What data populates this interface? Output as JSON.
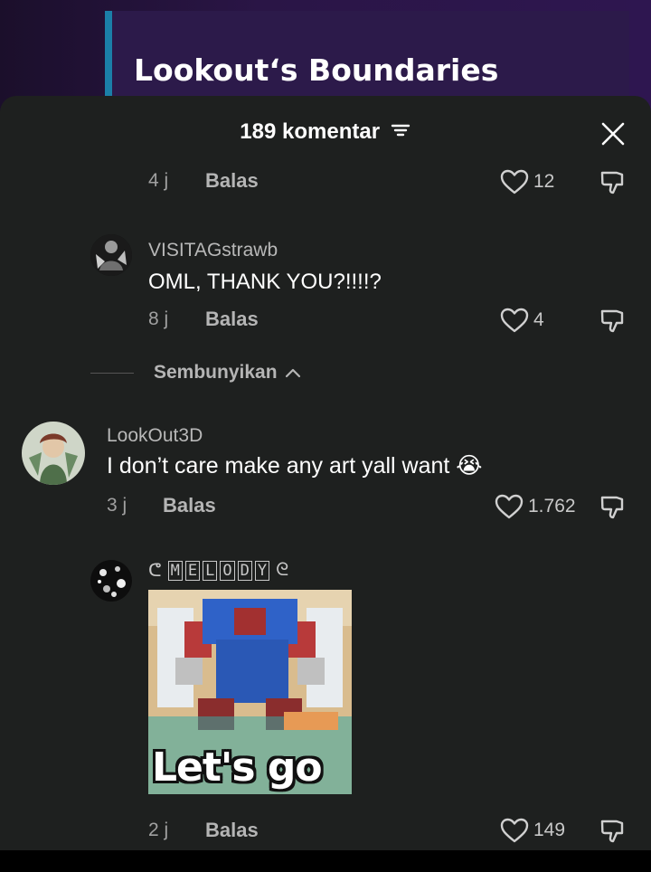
{
  "video": {
    "title": "Lookout‘s Boundaries"
  },
  "sheet": {
    "comment_count": "189 komentar"
  },
  "comments": [
    {
      "time": "4 j",
      "reply": "Balas",
      "likes": "12"
    },
    {
      "username": "VISITAGstrawb",
      "text": "OML, THANK YOU?!!!!?",
      "time": "8 j",
      "reply": "Balas",
      "likes": "4"
    }
  ],
  "hide_replies": {
    "label": "Sembunyikan"
  },
  "main_comment": {
    "username": "LookOut3D",
    "text": "I don’t care make any art yall want 😭",
    "time": "3 j",
    "reply": "Balas",
    "likes": "1.762"
  },
  "reply_comment": {
    "username": "ᕦ MELODY ᘓ",
    "username_letters": [
      "M",
      "E",
      "L",
      "O",
      "D",
      "Y"
    ],
    "username_prefix": "ᕦ",
    "username_suffix": "ᘓ",
    "sticker_text": "Let's go",
    "time": "2 j",
    "reply": "Balas",
    "likes": "149"
  },
  "colors": {
    "sheet_bg": "#1e201f",
    "video_bg": "#2c1a4a",
    "accent": "#1b7fa8"
  },
  "icons": {
    "filter": "filter-icon",
    "close": "close-icon",
    "like": "heart-outline-icon",
    "dislike": "thumbs-down-icon"
  }
}
